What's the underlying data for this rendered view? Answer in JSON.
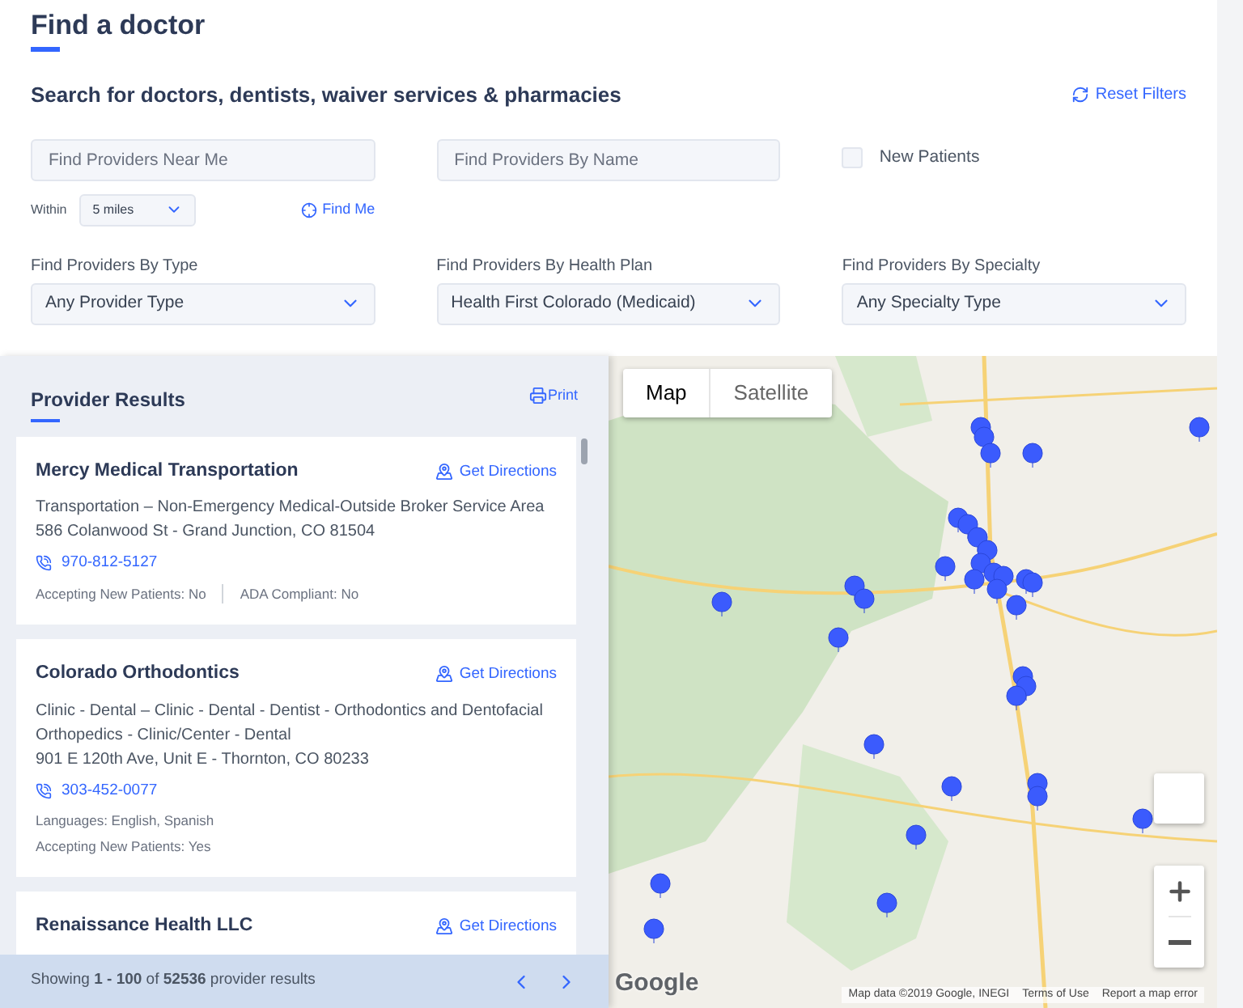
{
  "page": {
    "title": "Find a doctor"
  },
  "search": {
    "heading": "Search for doctors, dentists, waiver services & pharmacies",
    "reset": "Reset Filters",
    "near_field": {
      "placeholder": "Find Providers Near Me"
    },
    "name_field": {
      "placeholder": "Find Providers By Name"
    },
    "new_patients": {
      "label": "New Patients",
      "checked": false
    },
    "within": {
      "label": "Within",
      "value": "5 miles"
    },
    "find_me": "Find Me",
    "dropdowns": [
      {
        "label": "Find Providers By Type",
        "value": "Any Provider Type"
      },
      {
        "label": "Find Providers By Health Plan",
        "value": "Health First Colorado (Medicaid)"
      },
      {
        "label": "Find Providers By Specialty",
        "value": "Any Specialty Type"
      }
    ]
  },
  "results": {
    "title": "Provider Results",
    "print": "Print",
    "providers": [
      {
        "name": "Mercy Medical Transportation",
        "directions": "Get Directions",
        "description": "Transportation – Non-Emergency Medical-Outside Broker Service Area",
        "address": "586 Colanwood St - Grand Junction, CO 81504",
        "phone": "970-812-5127",
        "details": [
          [
            "Accepting New Patients: No",
            "ADA Compliant: No"
          ]
        ]
      },
      {
        "name": "Colorado Orthodontics",
        "directions": "Get Directions",
        "description": "Clinic - Dental – Clinic - Dental - Dentist - Orthodontics and Dentofacial Orthopedics - Clinic/Center - Dental",
        "address": "901 E 120th Ave, Unit E - Thornton, CO 80233",
        "phone": "303-452-0077",
        "details": [
          [
            "Languages: English, Spanish"
          ],
          [
            "Accepting New Patients: Yes"
          ]
        ]
      },
      {
        "name": "Renaissance Health LLC",
        "directions": "Get Directions"
      }
    ],
    "footer": "Showing **1 - 100** of **52536** provider results"
  },
  "map": {
    "tabs": [
      {
        "label": "Map",
        "selected": true
      },
      {
        "label": "Satellite",
        "selected": false
      }
    ],
    "logo": "Google",
    "attribution": "Map data ©2019 Google, INEGI",
    "terms": "Terms of Use",
    "report": "Report a map error"
  }
}
